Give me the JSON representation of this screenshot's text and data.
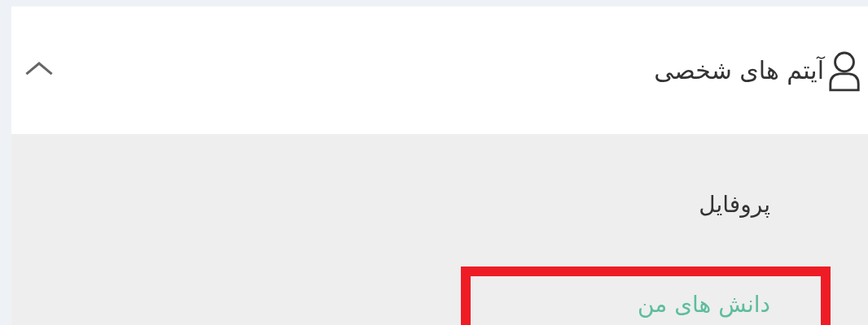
{
  "section": {
    "title": "آیتم های شخصی",
    "expanded": true
  },
  "items": [
    {
      "label": "پروفایل",
      "selected": false,
      "highlighted": false
    },
    {
      "label": "دانش های من",
      "selected": true,
      "highlighted": true
    }
  ]
}
